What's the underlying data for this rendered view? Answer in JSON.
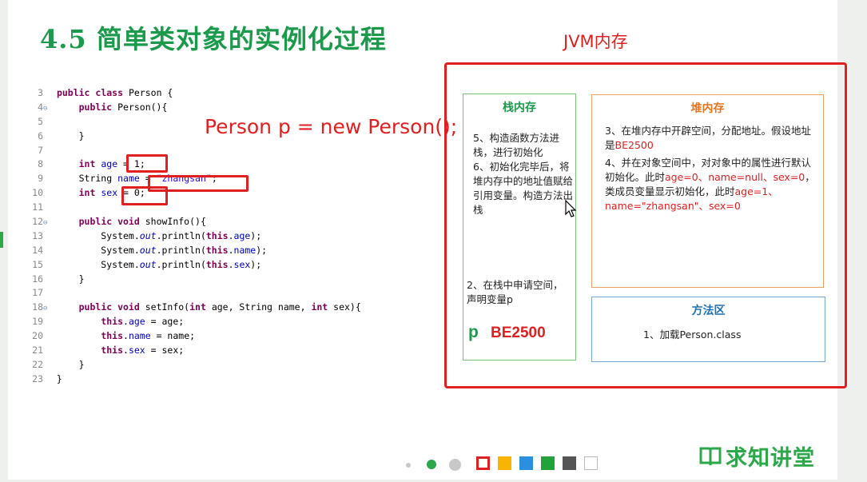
{
  "slide": {
    "title": "4.5 简单类对象的实例化过程",
    "jvm_label": "JVM内存",
    "code_annotation": "Person p = new Person();"
  },
  "code_lines": [
    {
      "n": "3",
      "fold": "",
      "html": "<span class='kw'>public class</span> Person {"
    },
    {
      "n": "4",
      "fold": "⊖",
      "html": "    <span class='kw'>public</span> Person(){"
    },
    {
      "n": "5",
      "fold": "",
      "html": ""
    },
    {
      "n": "6",
      "fold": "",
      "html": "    }"
    },
    {
      "n": "7",
      "fold": "",
      "html": ""
    },
    {
      "n": "8",
      "fold": "",
      "html": "    <span class='kw'>int</span> <span class='fld'>age</span> = 1;"
    },
    {
      "n": "9",
      "fold": "",
      "html": "    String <span class='fld'>name</span> = <span class='str'>\"zhangsan\"</span>;"
    },
    {
      "n": "10",
      "fold": "",
      "html": "    <span class='kw'>int</span> <span class='fld'>sex</span> = 0;"
    },
    {
      "n": "11",
      "fold": "",
      "html": ""
    },
    {
      "n": "12",
      "fold": "⊖",
      "html": "    <span class='kw'>public void</span> showInfo(){"
    },
    {
      "n": "13",
      "fold": "",
      "html": "        System.<span class='sta'>out</span>.println(<span class='kw'>this</span>.<span class='fld'>age</span>);"
    },
    {
      "n": "14",
      "fold": "",
      "html": "        System.<span class='sta'>out</span>.println(<span class='kw'>this</span>.<span class='fld'>name</span>);"
    },
    {
      "n": "15",
      "fold": "",
      "html": "        System.<span class='sta'>out</span>.println(<span class='kw'>this</span>.<span class='fld'>sex</span>);"
    },
    {
      "n": "16",
      "fold": "",
      "html": "    }"
    },
    {
      "n": "17",
      "fold": "",
      "html": ""
    },
    {
      "n": "18",
      "fold": "⊖",
      "html": "    <span class='kw'>public void</span> setInfo(<span class='kw'>int</span> age, String name, <span class='kw'>int</span> sex){"
    },
    {
      "n": "19",
      "fold": "",
      "html": "        <span class='kw'>this</span>.<span class='fld'>age</span> = age;"
    },
    {
      "n": "20",
      "fold": "",
      "html": "        <span class='kw'>this</span>.<span class='fld'>name</span> = name;"
    },
    {
      "n": "21",
      "fold": "",
      "html": "        <span class='kw'>this</span>.<span class='fld'>sex</span> = sex;"
    },
    {
      "n": "22",
      "fold": "",
      "html": "    }"
    },
    {
      "n": "23",
      "fold": "",
      "html": "}"
    }
  ],
  "stack": {
    "title": "栈内存",
    "step56": "5、构造函数方法进栈，进行初始化\n6、初始化完毕后，将堆内存中的地址值赋给引用变量。构造方法出栈",
    "step2": "2、在栈中申请空间，声明变量p",
    "var": "p",
    "addr": "BE2500"
  },
  "heap": {
    "title": "堆内存",
    "step3_a": "3、在堆内存中开辟空间，分配地址。假设地址是",
    "step3_addr": "BE2500",
    "step4_a": "4、并在对象空间中，对对象中的属性进行默认初始化。此时",
    "step4_r1": "age=0、name=null、sex=0",
    "step4_b": "，类成员变量显示初始化，此时",
    "step4_r2": "age=1、name=\"zhangsan\"、sex=0"
  },
  "method": {
    "title": "方法区",
    "step1": "1、加载Person.class"
  },
  "brand": {
    "name": "求知讲堂",
    "icon": "book-icon"
  },
  "colors": {
    "title_green": "#1a9a4a",
    "annotation_red": "#e02020",
    "heap_orange": "#e8731a",
    "method_blue": "#1f6fb5",
    "nav_swatches": [
      "#e02020",
      "#f7b500",
      "#2b8fe0",
      "#22a33a",
      "#555555",
      "#ffffff"
    ]
  }
}
